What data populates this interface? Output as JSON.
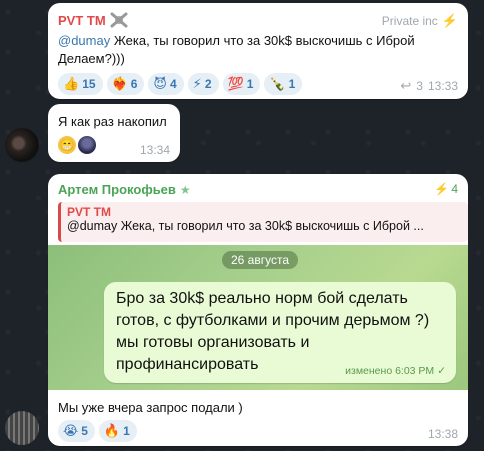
{
  "msg1": {
    "sender": "PVT TM",
    "badge": "Private inc",
    "mention": "@dumay",
    "text_line1": " Жека, ты говорил что за 30k$ выскочишь с Иброй",
    "text_line2": "Делаем?)))",
    "reactions": [
      {
        "emoji": "👍",
        "count": "15"
      },
      {
        "emoji": "❤️‍🔥",
        "count": "6"
      },
      {
        "emoji": "😈",
        "count": "4"
      },
      {
        "emoji": "⚡",
        "count": "2"
      },
      {
        "emoji": "💯",
        "count": "1"
      },
      {
        "emoji": "🍾",
        "count": "1"
      }
    ],
    "replies": "3",
    "time": "13:33"
  },
  "msg2": {
    "text": "Я как раз накопил",
    "time": "13:34"
  },
  "msg3": {
    "sender": "Артем Прокофьев",
    "badge_count": "4",
    "quote_sender": "PVT TM",
    "quote_mention": "@dumay",
    "quote_text": " Жека, ты говорил что за 30k$ выскочишь с Иброй ...",
    "date_chip": "26 августа",
    "inner_text_lines": [
      "Бро за 30k$ реально норм бой сделать",
      "готов, с футболками и прочим дерьмом ?)",
      "мы готовы организовать и",
      "профинансировать"
    ],
    "inner_meta": "изменено 6:03 PM",
    "caption": "Мы уже вчера запрос подали )",
    "reactions": [
      {
        "emoji": "😭",
        "count": "5"
      },
      {
        "emoji": "🔥",
        "count": "1"
      }
    ],
    "time": "13:38"
  },
  "colors": {
    "accent_red": "#e24a4a",
    "accent_green": "#4aa456",
    "reaction_blue": "#3a77b0"
  }
}
